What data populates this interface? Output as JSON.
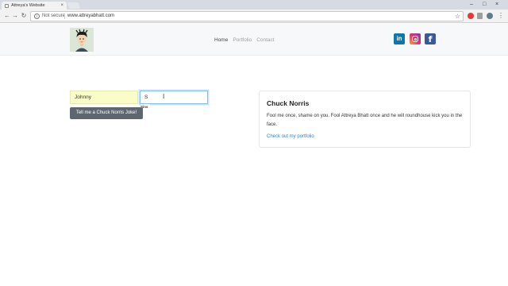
{
  "browser": {
    "tab_title": "Attreya's Website",
    "tab_close": "×",
    "security_label": "Not secure",
    "url": "www.attreyabhatt.com",
    "back": "←",
    "forward": "→",
    "reload": "↻",
    "bookmark": "☆",
    "menu": "⋮",
    "minimize": "–",
    "maximize": "□",
    "close": "×"
  },
  "site": {
    "nav": {
      "home": "Home",
      "portfolio": "Portfolio",
      "contact": "Contact"
    },
    "social": {
      "linkedin": "in",
      "facebook": "f"
    }
  },
  "form": {
    "first_name_value": "Johnny",
    "last_name_value": "S",
    "autocomplete_suggestion": "Sins",
    "submit_label": "Tell me a Chuck Norris Joke!"
  },
  "card": {
    "title": "Chuck Norris",
    "text": "Fool me once, shame on you. Fool Attreya Bhatt once and he will roundhouse kick you in the face.",
    "link": "Check out my portfolio"
  },
  "colors": {
    "brand_linkedin": "#0e76a8",
    "brand_facebook": "#3b5998",
    "button_bg": "#5e6770",
    "link": "#2f7ed8",
    "autofill_bg": "#fafdc7"
  }
}
